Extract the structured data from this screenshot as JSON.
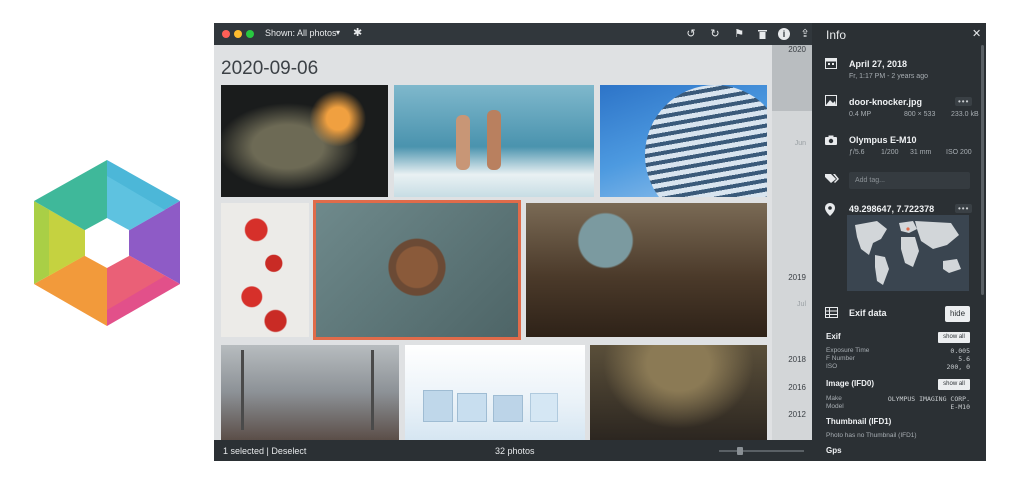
{
  "app": {
    "filter_label": "Shown: All photos",
    "window_colors": {
      "close": "#ff5f57",
      "minimize": "#febc2e",
      "maximize": "#28c840"
    }
  },
  "grid": {
    "date_heading": "2020-09-06",
    "photos": [
      "lightbulb",
      "swimmers",
      "tower",
      "tomatoes",
      "door-knocker",
      "globe-desk",
      "railway",
      "ice-cubes",
      "market-crowd"
    ],
    "selected_photo": "door-knocker"
  },
  "timeline": {
    "labels": [
      "2020",
      "Jun",
      "2019",
      "Jul",
      "2018",
      "2016",
      "2012"
    ]
  },
  "status": {
    "selection": "1 selected | Deselect",
    "count": "32 photos"
  },
  "info": {
    "title": "Info",
    "date": "April 27, 2018",
    "date_sub": "Fr, 1:17 PM - 2 years ago",
    "file": {
      "name": "door-knocker.jpg",
      "mp": "0.4 MP",
      "dims": "800 × 533",
      "size": "233.0 kB"
    },
    "camera": {
      "name": "Olympus E-M10",
      "aperture": "ƒ/5.6",
      "shutter": "1/200",
      "focal": "31 mm",
      "iso": "ISO 200"
    },
    "tag_placeholder": "Add tag...",
    "location": "49.298647, 7.722378",
    "exif": {
      "title": "Exif data",
      "hide_label": "hide",
      "show_all_label": "show all",
      "exif_heading": "Exif",
      "rows": [
        {
          "label": "Exposure Time",
          "value": "0.005"
        },
        {
          "label": "F Number",
          "value": "5.6"
        },
        {
          "label": "ISO",
          "value": "200, 0"
        }
      ],
      "image_heading": "Image (IFD0)",
      "image_rows": [
        {
          "label": "Make",
          "value": "OLYMPUS IMAGING CORP."
        },
        {
          "label": "Model",
          "value": "E-M10"
        }
      ],
      "thumb_heading": "Thumbnail (IFD1)",
      "thumb_note": "Photo has no Thumbnail (IFD1)",
      "gps_heading": "Gps"
    }
  },
  "colors": {
    "accent": "#e06b4a",
    "panel": "#2b3034",
    "grid_bg": "#dfe1e3"
  }
}
